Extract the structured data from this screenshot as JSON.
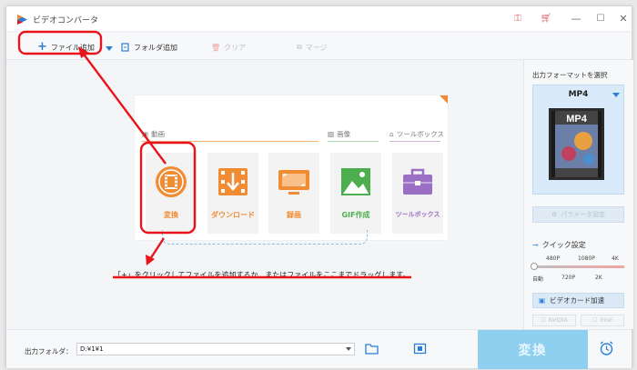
{
  "app": {
    "title": "ビデオコンバータ"
  },
  "toolbar": {
    "add_file": "ファイル追加",
    "add_folder": "フォルダ追加",
    "clear": "クリア",
    "merge": "マージ"
  },
  "categories": {
    "video": "動画",
    "screen": "画像",
    "toolbox": "ツールボックス"
  },
  "tiles": [
    {
      "label": "変換",
      "color": "#f28c33"
    },
    {
      "label": "ダウンロード",
      "color": "#f28c33"
    },
    {
      "label": "録画",
      "color": "#f28c33"
    },
    {
      "label": "GIF作成",
      "color": "#4cae4c"
    },
    {
      "label": "ツールボックス",
      "color": "#9b6fc3"
    }
  ],
  "hint": "「+」をクリックしてファイルを追加するか、またはファイルをここまでドラッグします。",
  "side": {
    "title": "出力フォーマットを選択",
    "format": "MP4",
    "format_thumb_text": "MP4",
    "param_button": "パラメータ設定",
    "quick_settings": "クイック設定",
    "slider_top": [
      "480P",
      "1080P",
      "4K"
    ],
    "slider_bottom": [
      "自動",
      "720P",
      "2K"
    ],
    "gpu": "ビデオカード加速",
    "vendors": [
      "NVIDIA",
      "Intel"
    ]
  },
  "bottom": {
    "output_label": "出力フォルダ：",
    "output_path": "D:¥1¥1",
    "convert": "変換"
  },
  "colors": {
    "accent": "#2a7fd4",
    "orange": "#f28c33",
    "annotation": "#e8141b"
  }
}
